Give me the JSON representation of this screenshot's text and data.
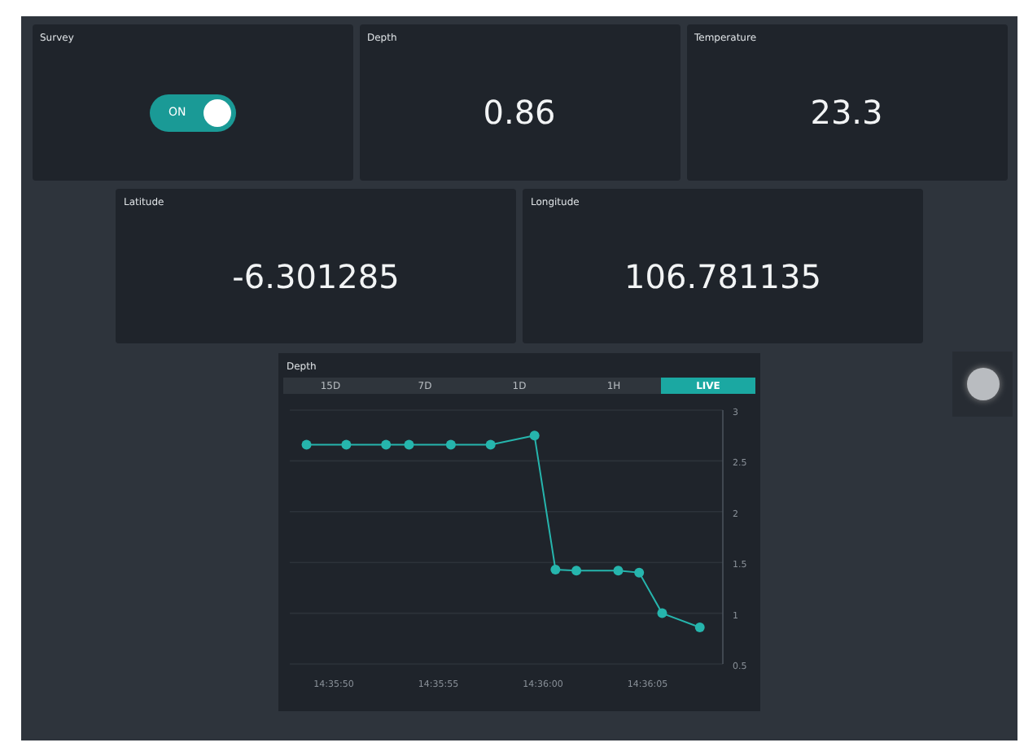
{
  "cards_top": [
    {
      "kind": "toggle",
      "title": "Survey",
      "label": "ON",
      "on": true
    },
    {
      "kind": "value",
      "title": "Depth",
      "value": "0.86"
    },
    {
      "kind": "value",
      "title": "Temperature",
      "value": "23.3"
    }
  ],
  "cards_mid": [
    {
      "kind": "value",
      "title": "Latitude",
      "value": "-6.301285"
    },
    {
      "kind": "value",
      "title": "Longitude",
      "value": "106.781135"
    }
  ],
  "chart_card": {
    "title": "Depth",
    "ranges": [
      {
        "label": "15D",
        "selected": false
      },
      {
        "label": "7D",
        "selected": false
      },
      {
        "label": "1D",
        "selected": false
      },
      {
        "label": "1H",
        "selected": false
      },
      {
        "label": "LIVE",
        "selected": true
      }
    ],
    "chart_data": {
      "type": "line",
      "grid": true,
      "x": [
        52548.7,
        52550.6,
        52552.5,
        52553.6,
        52555.6,
        52557.5,
        52559.6,
        52560.6,
        52561.6,
        52563.6,
        52564.6,
        52565.7,
        52567.5
      ],
      "series": [
        {
          "marker": "circle",
          "color": "#26b5ad",
          "values": [
            2.66,
            2.66,
            2.66,
            2.66,
            2.66,
            2.66,
            2.75,
            1.43,
            1.42,
            1.42,
            1.4,
            1.0,
            0.86
          ]
        }
      ],
      "xlim": [
        52547.9,
        52568.6
      ],
      "ylim": [
        0.5,
        3
      ],
      "xticks": [
        {
          "value": 52550,
          "label": "14:35:50"
        },
        {
          "value": 52555,
          "label": "14:35:55"
        },
        {
          "value": 52560,
          "label": "14:36:00"
        },
        {
          "value": 52565,
          "label": "14:36:05"
        }
      ],
      "yticks": [
        {
          "value": 3,
          "label": "3"
        },
        {
          "value": 2.5,
          "label": "2.5"
        },
        {
          "value": 2,
          "label": "2"
        },
        {
          "value": 1.5,
          "label": "1.5"
        },
        {
          "value": 1,
          "label": "1"
        },
        {
          "value": 0.5,
          "label": "0.5"
        }
      ]
    }
  }
}
